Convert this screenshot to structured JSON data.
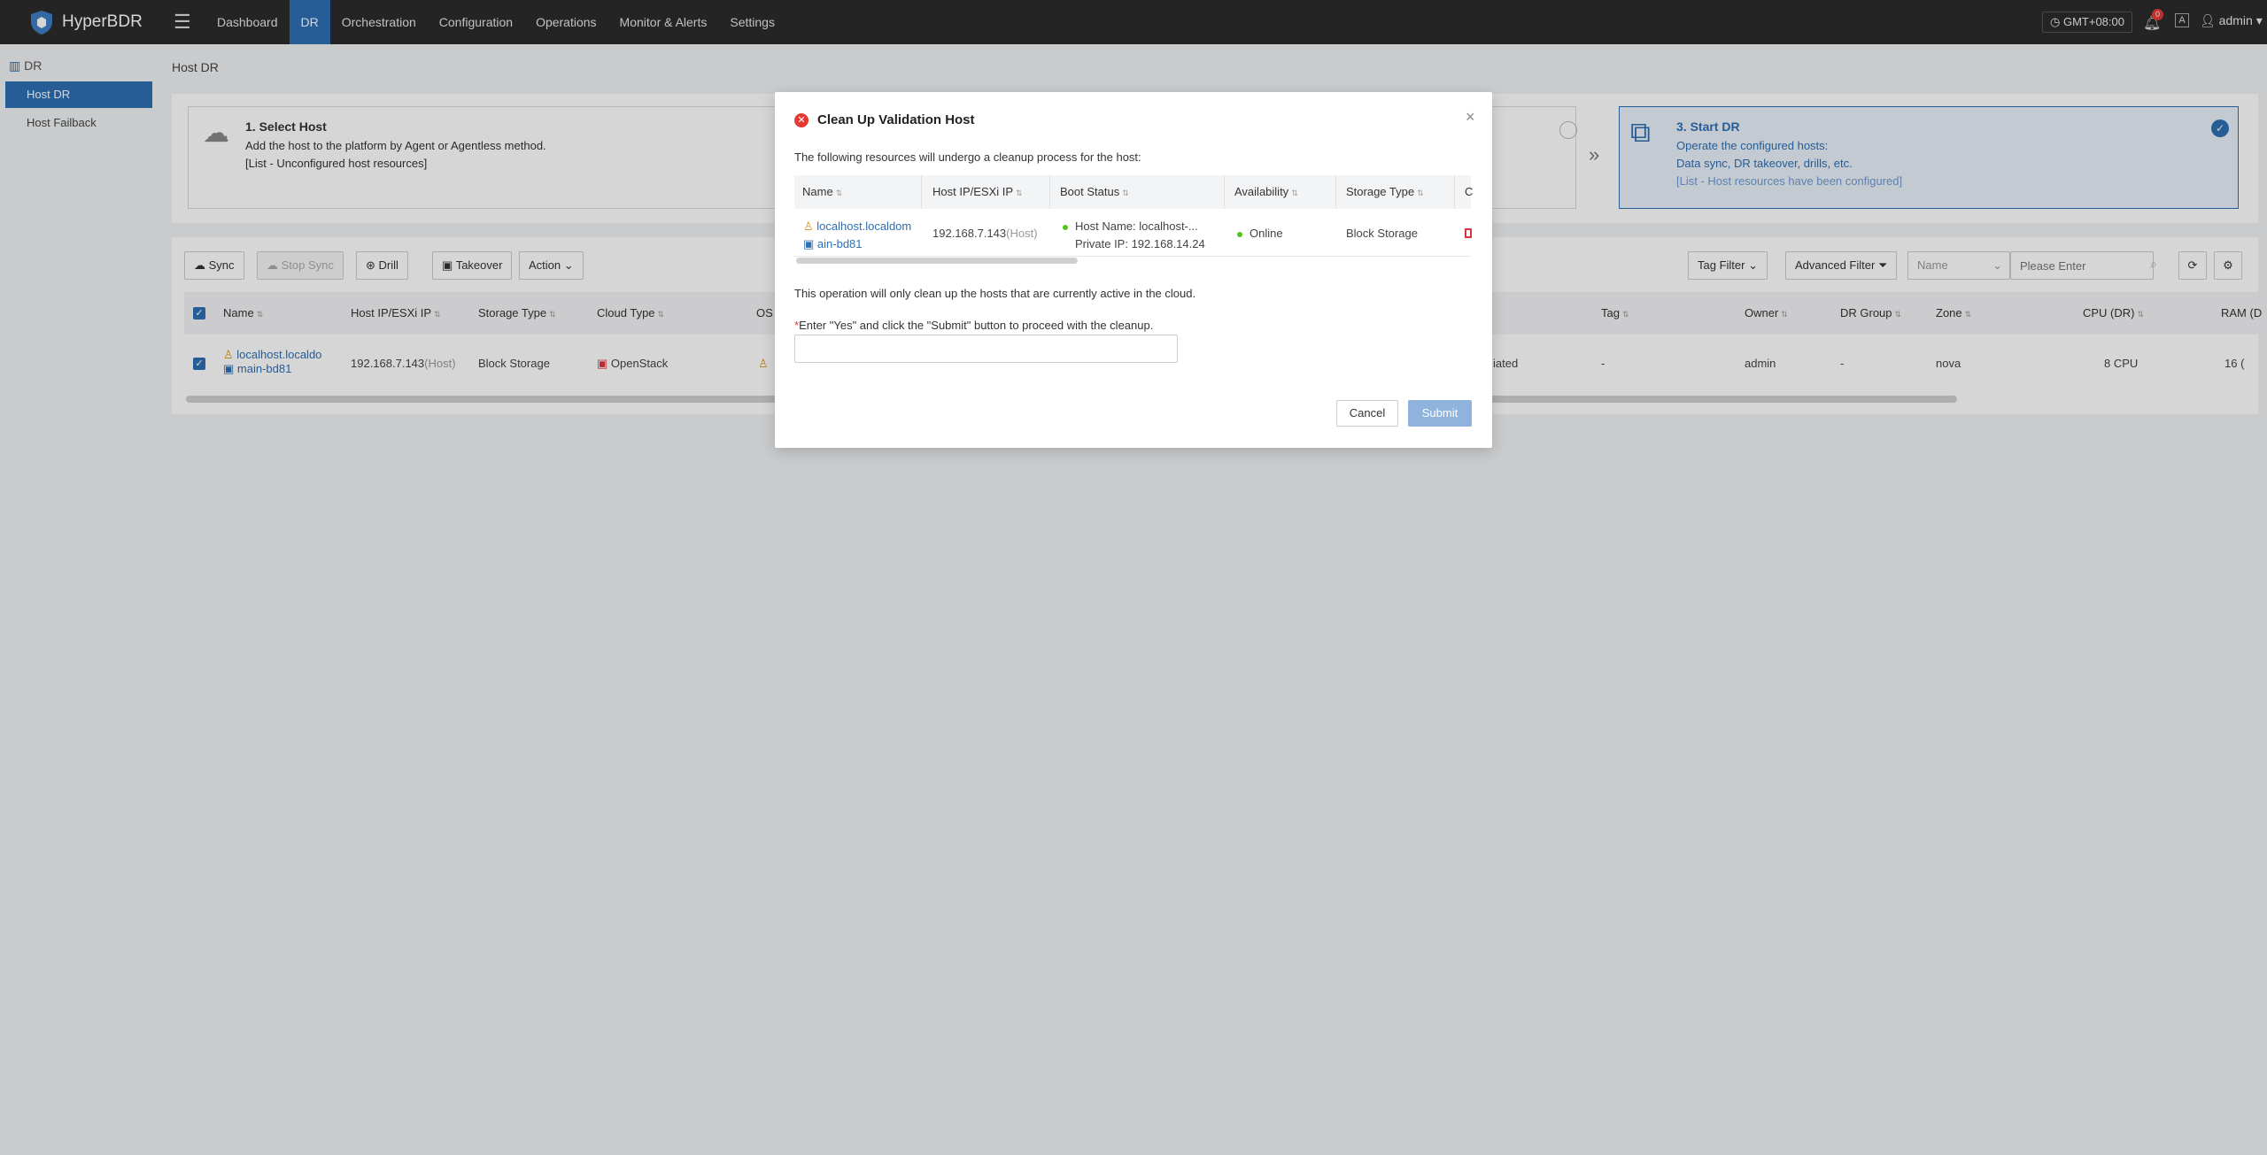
{
  "app": {
    "name": "HyperBDR"
  },
  "nav": {
    "items": [
      "Dashboard",
      "DR",
      "Orchestration",
      "Configuration",
      "Operations",
      "Monitor & Alerts",
      "Settings"
    ]
  },
  "topbar": {
    "timezone": "GMT+08:00",
    "notifications": "0",
    "user": "admin"
  },
  "sidebar": {
    "header": "DR",
    "items": [
      "Host DR",
      "Host Failback"
    ]
  },
  "breadcrumb": "Host DR",
  "steps": {
    "step1": {
      "title": "1. Select Host",
      "line1": "Add the host to the platform by Agent or Agentless method.",
      "line2": "[List - Unconfigured host resources]"
    },
    "step3": {
      "title": "3. Start DR",
      "line1": "Operate the configured hosts:",
      "line2": "Data sync, DR takeover, drills, etc.",
      "line3": "[List - Host resources have been configured]"
    }
  },
  "toolbar": {
    "sync": "Sync",
    "stop_sync": "Stop Sync",
    "drill": "Drill",
    "takeover": "Takeover",
    "action": "Action",
    "tag_filter": "Tag Filter",
    "advanced_filter": "Advanced Filter",
    "search_field": "Name",
    "search_placeholder": "Please Enter"
  },
  "table": {
    "columns": [
      "Name",
      "Host IP/ESXi IP",
      "Storage Type",
      "Cloud Type",
      "OS",
      "Tag",
      "Owner",
      "DR Group",
      "Zone",
      "CPU (DR)",
      "RAM (D"
    ],
    "row": {
      "name_line1": "localhost.localdo",
      "name_line2": "main-bd81",
      "ip": "192.168.7.143",
      "ip_suffix": "(Host)",
      "storage": "Block Storage",
      "cloud": "OpenStack",
      "status_partial": "iated",
      "tag": "-",
      "owner": "admin",
      "dr_group": "-",
      "zone": "nova",
      "cpu": "8 CPU",
      "ram": "16 ("
    }
  },
  "modal": {
    "title": "Clean Up Validation Host",
    "intro": "The following resources will undergo a cleanup process for the host:",
    "columns": [
      "Name",
      "Host IP/ESXi IP",
      "Boot Status",
      "Availability",
      "Storage Type",
      "C"
    ],
    "row": {
      "name_line1": "localhost.localdom",
      "name_line2": "ain-bd81",
      "ip": "192.168.7.143",
      "ip_suffix": "(Host)",
      "boot_line1": "Host Name: localhost-...",
      "boot_line2": "Private IP: 192.168.14.24",
      "availability": "Online",
      "storage": "Block Storage"
    },
    "note": "This operation will only clean up the hosts that are currently active in the cloud.",
    "prompt": "Enter \"Yes\" and click the \"Submit\" button to proceed with the cleanup.",
    "cancel": "Cancel",
    "submit": "Submit"
  }
}
